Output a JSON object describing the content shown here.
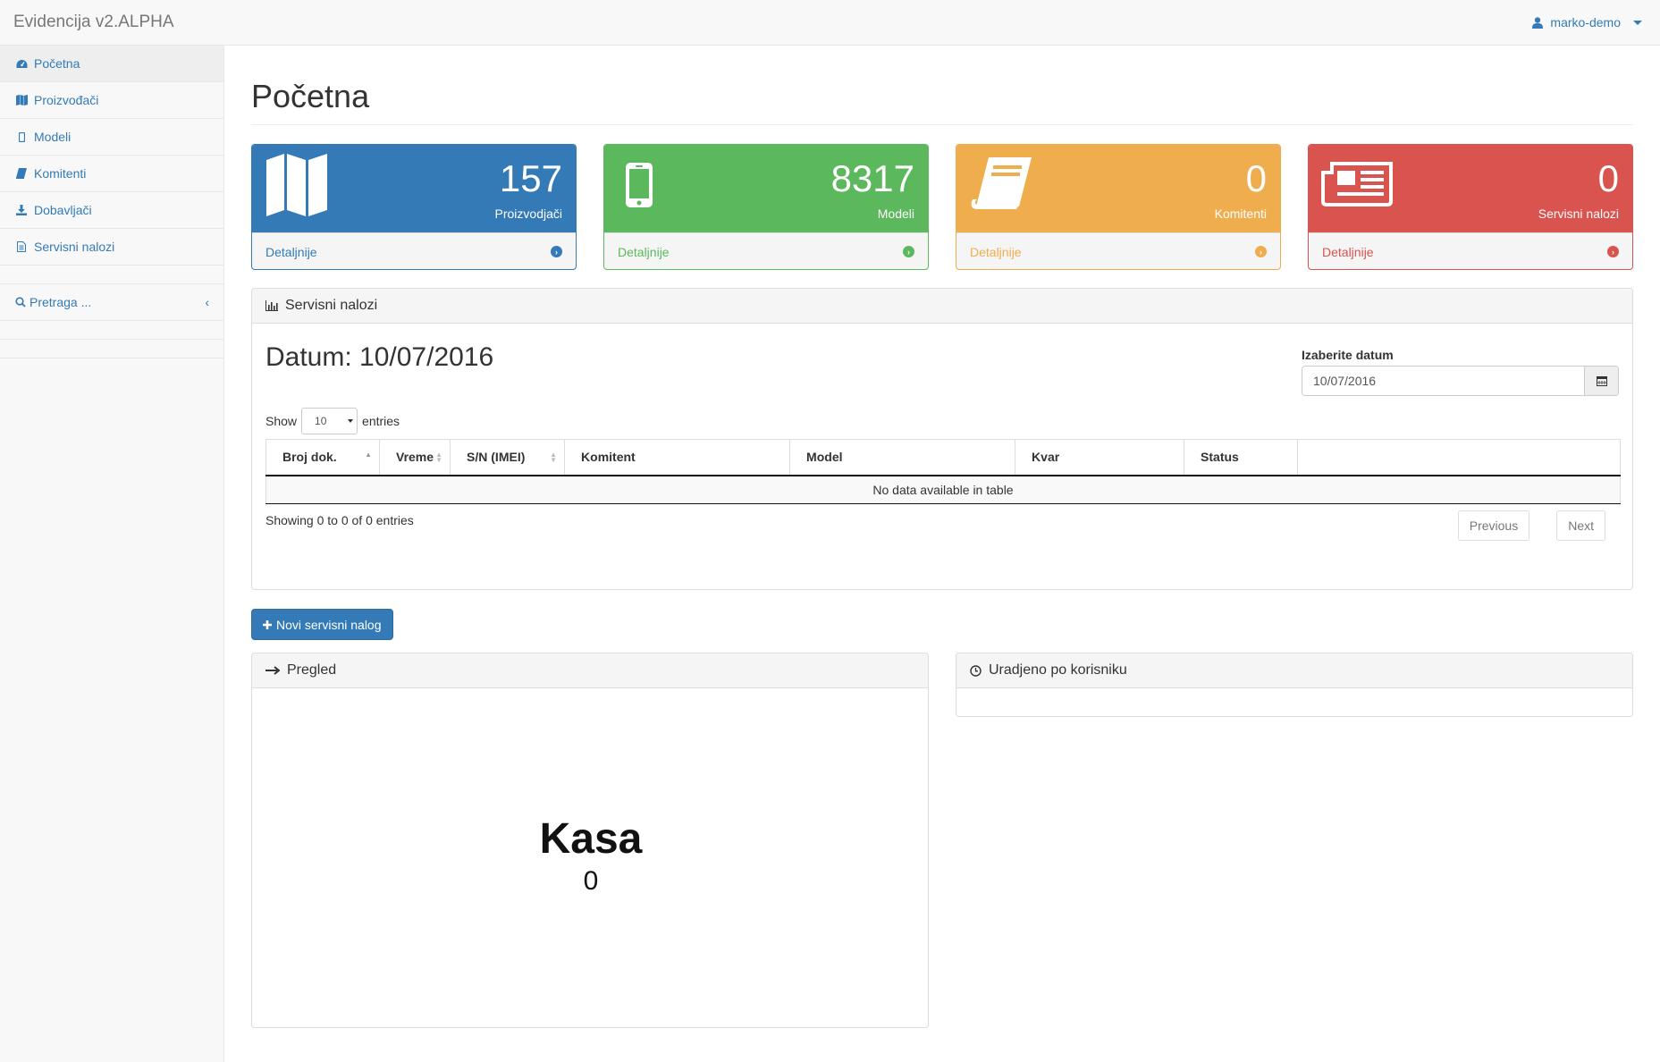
{
  "app": {
    "brand": "Evidencija v2.ALPHA",
    "user": "marko-demo"
  },
  "sidebar": {
    "items": [
      {
        "label": "Početna",
        "icon": "dashboard-icon"
      },
      {
        "label": "Proizvođači",
        "icon": "map-icon"
      },
      {
        "label": "Modeli",
        "icon": "mobile-icon"
      },
      {
        "label": "Komitenti",
        "icon": "book-icon"
      },
      {
        "label": "Dobavljači",
        "icon": "download-icon"
      },
      {
        "label": "Servisni nalozi",
        "icon": "file-icon"
      }
    ],
    "search": {
      "label": "Pretraga ...",
      "chevron": "‹"
    }
  },
  "page": {
    "title": "Početna"
  },
  "cards": [
    {
      "count": "157",
      "label": "Proizvodjači",
      "link": "Detaljnije",
      "color": "#337ab7",
      "icon": "map-icon"
    },
    {
      "count": "8317",
      "label": "Modeli",
      "link": "Detaljnije",
      "color": "#5cb85c",
      "icon": "mobile-icon"
    },
    {
      "count": "0",
      "label": "Komitenti",
      "link": "Detaljnije",
      "color": "#f0ad4e",
      "icon": "book-icon"
    },
    {
      "count": "0",
      "label": "Servisni nalozi",
      "link": "Detaljnije",
      "color": "#d9534f",
      "icon": "newspaper-icon"
    }
  ],
  "orders": {
    "heading": "Servisni nalozi",
    "datum": "Datum: 10/07/2016",
    "date_label": "Izaberite datum",
    "date_value": "10/07/2016",
    "show_label": "Show",
    "entries_label": "entries",
    "page_size": "10",
    "columns": [
      "Broj dok.",
      "Vreme",
      "S/N (IMEI)",
      "Komitent",
      "Model",
      "Kvar",
      "Status",
      ""
    ],
    "empty": "No data available in table",
    "showing": "Showing 0 to 0 of 0 entries",
    "prev": "Previous",
    "next": "Next"
  },
  "new_button": "Novi servisni nalog",
  "pregled": {
    "heading": "Pregled",
    "kasa_label": "Kasa",
    "kasa_value": "0"
  },
  "uradjeno": {
    "heading": "Uradjeno po korisniku"
  }
}
